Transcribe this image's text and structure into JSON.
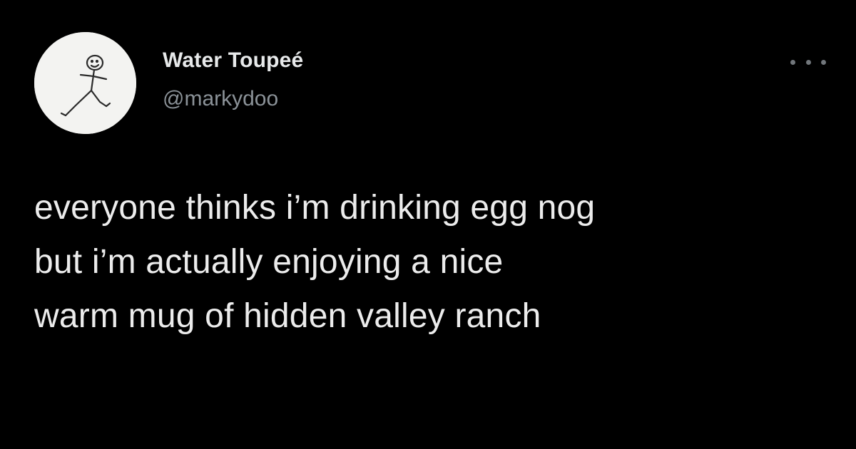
{
  "tweet": {
    "author": {
      "display_name": "Water Toupeé",
      "handle": "@markydoo",
      "avatar_icon": "stick-figure-avatar"
    },
    "more_icon": "more-options-icon",
    "text_lines": [
      "everyone thinks i’m drinking egg nog",
      "but i’m actually enjoying a nice",
      "warm mug of hidden valley ranch"
    ]
  },
  "colors": {
    "background": "#000000",
    "primary_text": "#e7e9ea",
    "secondary_text": "#8b9298",
    "avatar_background": "#f3f3f1"
  }
}
